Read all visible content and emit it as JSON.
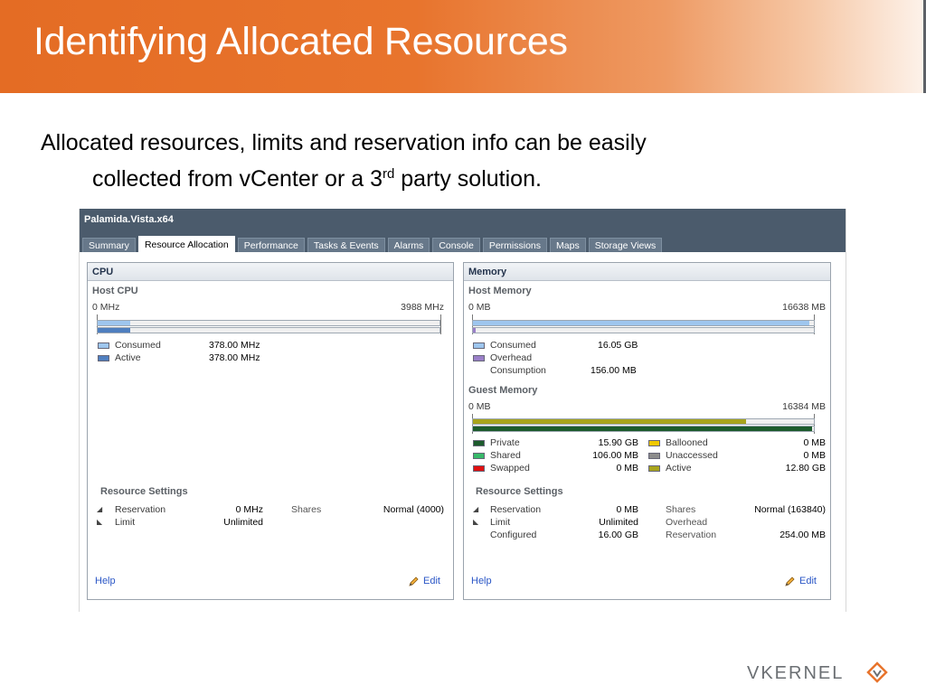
{
  "slide": {
    "title": "Identifying Allocated Resources",
    "text_line1": "Allocated resources, limits and reservation info can be easily",
    "text_line2a": "collected from vCenter or a 3",
    "text_sup": "rd",
    "text_line2b": " party solution."
  },
  "window": {
    "vm_name": "Palamida.Vista.x64",
    "tabs": [
      "Summary",
      "Resource Allocation",
      "Performance",
      "Tasks & Events",
      "Alarms",
      "Console",
      "Permissions",
      "Maps",
      "Storage Views"
    ],
    "active_tab": "Resource Allocation"
  },
  "cpu": {
    "title": "CPU",
    "host_label": "Host CPU",
    "scale_min": "0 MHz",
    "scale_max": "3988 MHz",
    "consumed_fraction": 0.095,
    "active_fraction": 0.095,
    "legend": [
      {
        "label": "Consumed",
        "value": "378.00 MHz",
        "color": "#9ec6ee"
      },
      {
        "label": "Active",
        "value": "378.00 MHz",
        "color": "#4f7fbf"
      }
    ],
    "settings_title": "Resource Settings",
    "reservation_label": "Reservation",
    "reservation_value": "0 MHz",
    "limit_label": "Limit",
    "limit_value": "Unlimited",
    "shares_label": "Shares",
    "shares_value": "Normal (4000)",
    "help": "Help",
    "edit": "Edit"
  },
  "memory": {
    "title": "Memory",
    "host_label": "Host Memory",
    "host_scale_min": "0 MB",
    "host_scale_max": "16638 MB",
    "host_consumed_fraction": 0.988,
    "host_overhead_fraction": 0.009,
    "host_legend": [
      {
        "label": "Consumed",
        "value": "16.05 GB",
        "color": "#9ec6ee"
      },
      {
        "label": "Overhead",
        "value": "",
        "color": "#9a7fc8"
      }
    ],
    "consumption_label": "Consumption",
    "consumption_value": "156.00 MB",
    "guest_label": "Guest Memory",
    "guest_scale_min": "0 MB",
    "guest_scale_max": "16384 MB",
    "guest_active_fraction": 0.8,
    "guest_private_fraction": 0.994,
    "guest_legend_left": [
      {
        "label": "Private",
        "value": "15.90 GB",
        "color": "#1c5b2c"
      },
      {
        "label": "Shared",
        "value": "106.00 MB",
        "color": "#38b96a"
      },
      {
        "label": "Swapped",
        "value": "0 MB",
        "color": "#e01010"
      }
    ],
    "guest_legend_right": [
      {
        "label": "Ballooned",
        "value": "0 MB",
        "color": "#f0c800"
      },
      {
        "label": "Unaccessed",
        "value": "0 MB",
        "color": "#8c8c8c"
      },
      {
        "label": "Active",
        "value": "12.80 GB",
        "color": "#a8a41c"
      }
    ],
    "settings_title": "Resource Settings",
    "reservation_label": "Reservation",
    "reservation_value": "0 MB",
    "limit_label": "Limit",
    "limit_value": "Unlimited",
    "configured_label": "Configured",
    "configured_value": "16.00 GB",
    "shares_label": "Shares",
    "shares_value": "Normal (163840)",
    "overhead_label": "Overhead",
    "overhead_value": "",
    "res2_label": "Reservation",
    "res2_value": "254.00 MB",
    "help": "Help",
    "edit": "Edit"
  },
  "logo": {
    "text": "VKERNEL"
  }
}
